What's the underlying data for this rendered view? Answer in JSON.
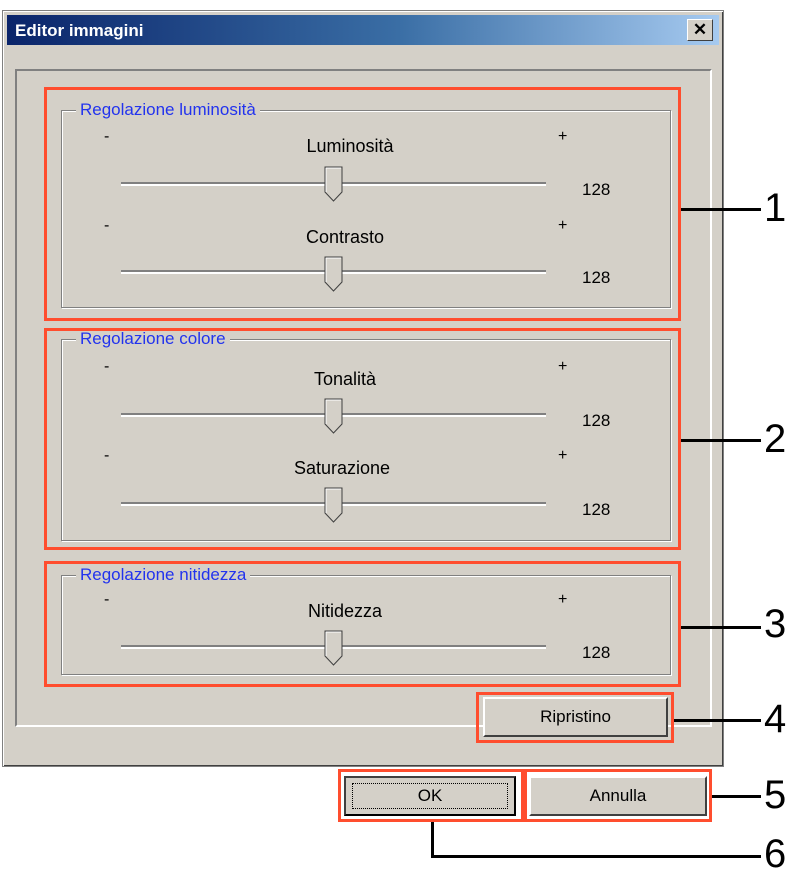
{
  "window": {
    "title": "Editor immagini",
    "close_label": "✕"
  },
  "groups": [
    {
      "legend": "Regolazione luminosità",
      "sliders": [
        {
          "label": "Luminosità",
          "minus": "-",
          "plus": "+",
          "value": "128",
          "position": 0.5
        },
        {
          "label": "Contrasto",
          "minus": "-",
          "plus": "+",
          "value": "128",
          "position": 0.5
        }
      ]
    },
    {
      "legend": "Regolazione colore",
      "sliders": [
        {
          "label": "Tonalità",
          "minus": "-",
          "plus": "+",
          "value": "128",
          "position": 0.5
        },
        {
          "label": "Saturazione",
          "minus": "-",
          "plus": "+",
          "value": "128",
          "position": 0.5
        }
      ]
    },
    {
      "legend": "Regolazione nitidezza",
      "sliders": [
        {
          "label": "Nitidezza",
          "minus": "-",
          "plus": "+",
          "value": "128",
          "position": 0.5
        }
      ]
    }
  ],
  "buttons": {
    "reset_label": "Ripristino",
    "ok_label": "OK",
    "cancel_label": "Annulla"
  },
  "callouts": [
    "1",
    "2",
    "3",
    "4",
    "5",
    "6"
  ],
  "colors": {
    "title_start": "#0a246a",
    "legend_text": "#2233ee",
    "highlight_box": "#ff4d2e",
    "dialog_bg": "#d4d0c8"
  }
}
